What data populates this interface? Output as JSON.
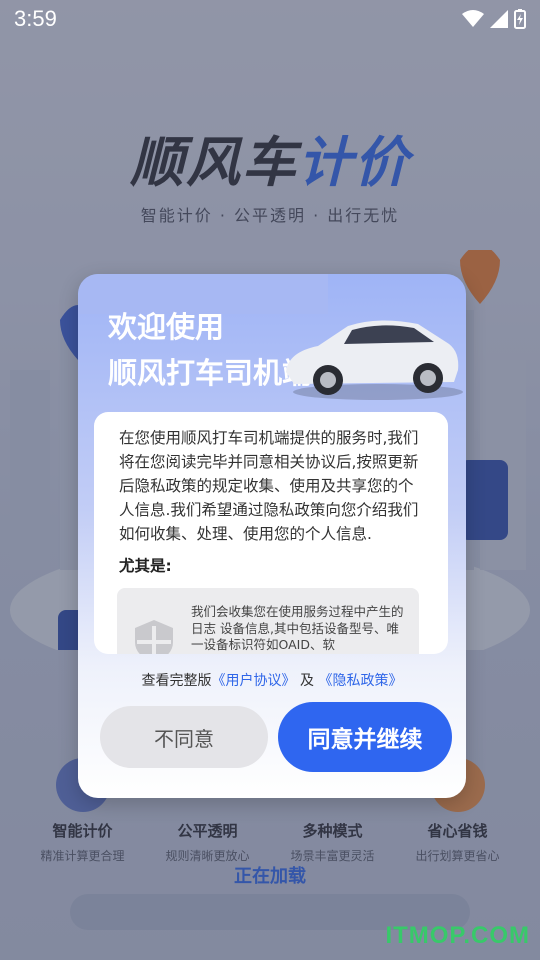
{
  "status_bar": {
    "time": "3:59"
  },
  "hero": {
    "title_main": "顺风车",
    "title_accent": "计价",
    "subtitle": "智能计价 · 公平透明 · 出行无忧"
  },
  "features": [
    {
      "title": "智能计价",
      "desc": "精准计算更合理"
    },
    {
      "title": "公平透明",
      "desc": "规则清晰更放心"
    },
    {
      "title": "多种模式",
      "desc": "场景丰富更灵活"
    },
    {
      "title": "省心省钱",
      "desc": "出行划算更省心"
    }
  ],
  "loading": {
    "text": "正在加载"
  },
  "watermark": "ITMOP.COM",
  "dialog": {
    "title_line1": "欢迎使用",
    "title_line2": "顺风打车司机端",
    "body": "在您使用顺风打车司机端提供的服务时,我们将在您阅读完毕并同意相关协议后,按照更新后隐私政策的规定收集、使用及共享您的个人信息.我们希望通过隐私政策向您介绍我们如何收集、处理、使用您的个人信息.",
    "label": "尤其是:",
    "info_text": "我们会收集您在使用服务过程中产生的日志 设备信息,其中包括设备型号、唯一设备标识符如OAID、软",
    "agreements": {
      "prefix": "查看完整版",
      "user_agreement": "《用户协议》",
      "joiner": "及",
      "privacy_policy": "《隐私政策》"
    },
    "disagree_label": "不同意",
    "agree_label": "同意并继续"
  },
  "colors": {
    "accent": "#2f66f0",
    "link": "#2f66e8",
    "watermark": "#38c96a"
  }
}
